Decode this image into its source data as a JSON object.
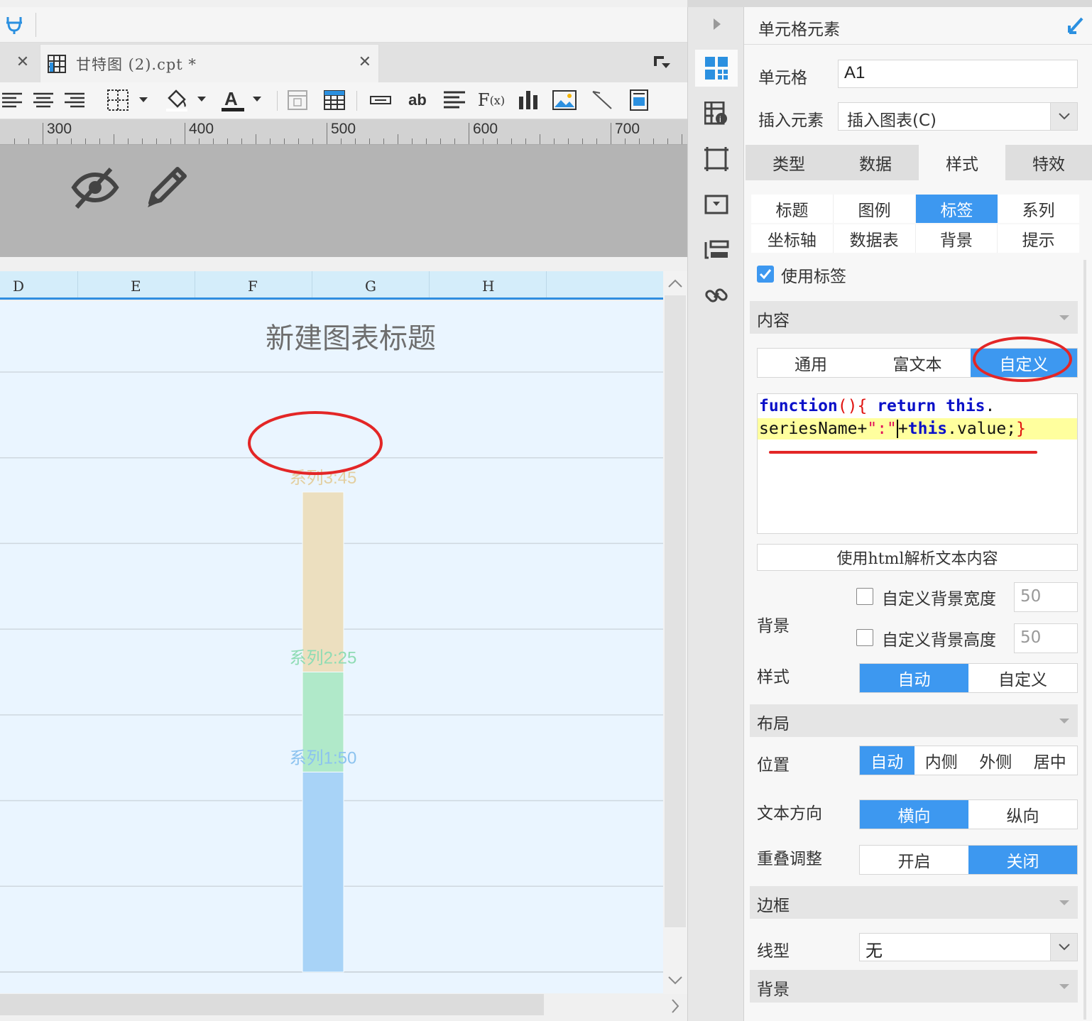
{
  "window": {
    "file_tab": "甘特图 (2).cpt *"
  },
  "ruler": {
    "labels": [
      "300",
      "400",
      "500",
      "600",
      "700"
    ]
  },
  "grid": {
    "columns": [
      "D",
      "E",
      "F",
      "G",
      "H"
    ]
  },
  "chart_data": {
    "type": "bar",
    "title": "新建图表标题",
    "categories": [
      ""
    ],
    "stacked": true,
    "series": [
      {
        "name": "系列1",
        "values": [
          50
        ],
        "color": "#a8d3f7"
      },
      {
        "name": "系列2",
        "values": [
          25
        ],
        "color": "#b0e9c9"
      },
      {
        "name": "系列3",
        "values": [
          45
        ],
        "color": "#ecdfbf"
      }
    ],
    "data_labels": [
      "系列3:45",
      "系列2:25",
      "系列1:50"
    ],
    "label_colors": [
      "#e3cfa0",
      "#8fdcb4",
      "#8cc3ef"
    ],
    "ylim": [
      0,
      150
    ],
    "grid": true
  },
  "panel": {
    "header": "单元格元素",
    "cell_label": "单元格",
    "cell_value": "A1",
    "insert_label": "插入元素",
    "insert_value": "插入图表(C)",
    "main_tabs": [
      "类型",
      "数据",
      "样式",
      "特效"
    ],
    "sub_tabs_row1": [
      "标题",
      "图例",
      "标签",
      "系列"
    ],
    "sub_tabs_row2": [
      "坐标轴",
      "数据表",
      "背景",
      "提示"
    ],
    "use_label": "使用标签",
    "content_section": "内容",
    "content_modes": [
      "通用",
      "富文本",
      "自定义"
    ],
    "code": {
      "kw_function": "function",
      "paren": "(){",
      "kw_return": "return",
      "kw_this": "this",
      "dot": ".",
      "prop": "seriesName",
      "plus": "+",
      "str": "\":\"",
      "kw_this2": "this",
      "tail": ".value;",
      "brace": "}"
    },
    "html_parse_btn": "使用html解析文本内容",
    "bg_label": "背景",
    "custom_bg_width": "自定义背景宽度",
    "custom_bg_width_value": "50",
    "custom_bg_height": "自定义背景高度",
    "custom_bg_height_value": "50",
    "style_label": "样式",
    "style_options": [
      "自动",
      "自定义"
    ],
    "layout_section": "布局",
    "position_label": "位置",
    "position_options": [
      "自动",
      "内侧",
      "外侧",
      "居中"
    ],
    "text_dir_label": "文本方向",
    "text_dir_options": [
      "横向",
      "纵向"
    ],
    "overlap_label": "重叠调整",
    "overlap_options": [
      "开启",
      "关闭"
    ],
    "border_section": "边框",
    "line_label": "线型",
    "line_value": "无",
    "bg_section": "背景"
  },
  "accent_color": "#3d98f0"
}
